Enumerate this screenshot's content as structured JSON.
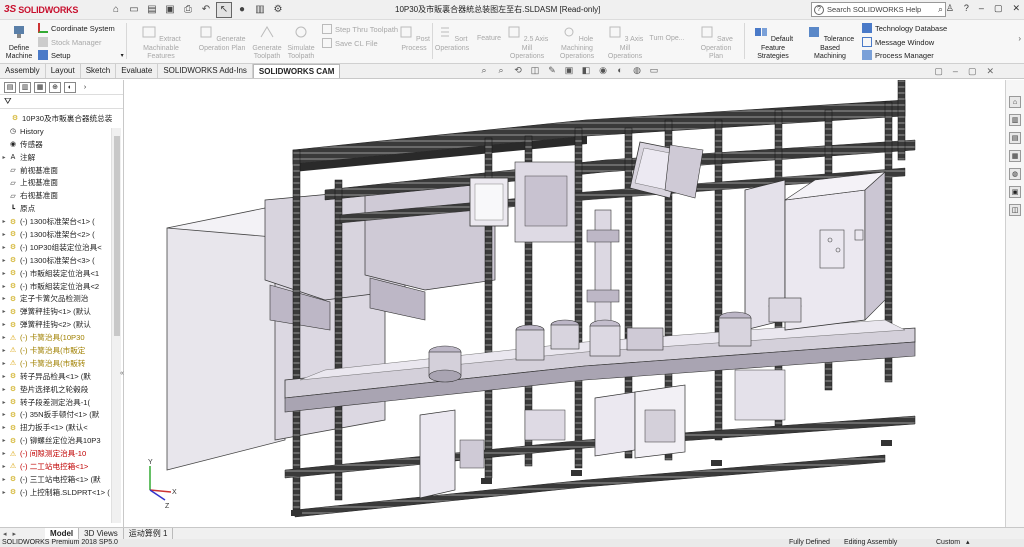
{
  "app": {
    "brand_prefix": "3S",
    "brand_name": "SOLIDWORKS",
    "window_title": "10P30及市販裏合器統总装图左至右.SLDASM [Read-only]",
    "help_search_placeholder": "Search SOLIDWORKS Help"
  },
  "ribbon": {
    "define_machine": "Define\nMachine",
    "coordinate_system": "Coordinate System",
    "stock_manager": "Stock Manager",
    "setup": "Setup",
    "extract_features": "Extract Machinable\nFeatures",
    "generate_operation_plan": "Generate\nOperation Plan",
    "generate_toolpath": "Generate\nToolpath",
    "simulate_toolpath": "Simulate\nToolpath",
    "step_thru_toolpath": "Step Thru Toolpath",
    "save_cl_file": "Save CL File",
    "post_process": "Post\nProcess",
    "sort_operations": "Sort\nOperations",
    "feature": "Feature",
    "mill_25": "2.5 Axis Mill\nOperations",
    "hole_machining": "Hole Machining\nOperations",
    "mill_3": "3 Axis Mill\nOperations",
    "turn_ops": "Turn Ope...",
    "save_operation_plan": "Save Operation\nPlan",
    "default_feature_strategies": "Default Feature\nStrategies",
    "tolerance_based_machining": "Tolerance Based\nMachining",
    "technology_database": "Technology Database",
    "message_window": "Message Window",
    "process_manager": "Process Manager"
  },
  "tabs": [
    "Assembly",
    "Layout",
    "Sketch",
    "Evaluate",
    "SOLIDWORKS Add-Ins",
    "SOLIDWORKS CAM"
  ],
  "active_tab": "SOLIDWORKS CAM",
  "feature_tree": {
    "items": [
      {
        "label": "10P30及市販裏合器统总装",
        "icon": "assembly-icon",
        "arrow": "",
        "state": "root"
      },
      {
        "label": "History",
        "icon": "history-icon",
        "arrow": "",
        "state": ""
      },
      {
        "label": "传感器",
        "icon": "sensor-icon",
        "arrow": "",
        "state": ""
      },
      {
        "label": "注解",
        "icon": "annotation-icon",
        "arrow": "▸",
        "state": ""
      },
      {
        "label": "前视基准面",
        "icon": "plane-icon",
        "arrow": "",
        "state": ""
      },
      {
        "label": "上视基准面",
        "icon": "plane-icon",
        "arrow": "",
        "state": ""
      },
      {
        "label": "右视基准面",
        "icon": "plane-icon",
        "arrow": "",
        "state": ""
      },
      {
        "label": "原点",
        "icon": "origin-icon",
        "arrow": "",
        "state": ""
      },
      {
        "label": "(-) 1300标准架台<1> (",
        "icon": "part-icon",
        "arrow": "▸",
        "state": ""
      },
      {
        "label": "(-) 1300标准架台<2> (",
        "icon": "part-icon",
        "arrow": "▸",
        "state": ""
      },
      {
        "label": "(-) 10P30组装定位治具<",
        "icon": "part-icon",
        "arrow": "▸",
        "state": ""
      },
      {
        "label": "(-) 1300标准架台<3> (",
        "icon": "part-icon",
        "arrow": "▸",
        "state": ""
      },
      {
        "label": "(-) 市販組装定位治具<1",
        "icon": "part-icon",
        "arrow": "▸",
        "state": ""
      },
      {
        "label": "(-) 市販組装定位治具<2",
        "icon": "part-icon",
        "arrow": "▸",
        "state": ""
      },
      {
        "label": "定子卡簧欠品检测治",
        "icon": "part-icon",
        "arrow": "▸",
        "state": ""
      },
      {
        "label": "弹簧秤挂钩<1> (默认",
        "icon": "part-icon",
        "arrow": "▸",
        "state": ""
      },
      {
        "label": "弹簧秤挂钩<2> (默认",
        "icon": "part-icon",
        "arrow": "▸",
        "state": ""
      },
      {
        "label": "(-) 卡簧治具(10P30",
        "icon": "warn-part-icon",
        "arrow": "▸",
        "state": "warn"
      },
      {
        "label": "(-) 卡簧治具(市販定",
        "icon": "warn-part-icon",
        "arrow": "▸",
        "state": "warn"
      },
      {
        "label": "(-) 卡簧治具(市販转",
        "icon": "warn-part-icon",
        "arrow": "▸",
        "state": "warn"
      },
      {
        "label": "转子异品检具<1> (默",
        "icon": "part-icon",
        "arrow": "▸",
        "state": ""
      },
      {
        "label": "垫片选择机之轮毂段",
        "icon": "part-icon",
        "arrow": "▸",
        "state": ""
      },
      {
        "label": "转子段差测定治具-1(",
        "icon": "part-icon",
        "arrow": "▸",
        "state": ""
      },
      {
        "label": "(-) 35N扳手顿付<1> (默",
        "icon": "part-icon",
        "arrow": "▸",
        "state": ""
      },
      {
        "label": "扭力扳手<1> (默认<",
        "icon": "part-icon",
        "arrow": "▸",
        "state": ""
      },
      {
        "label": "(-) 铆螺丝定位治具10P3",
        "icon": "part-icon",
        "arrow": "▸",
        "state": ""
      },
      {
        "label": "(-) 间隙测定治具-10",
        "icon": "warn-part-icon",
        "arrow": "▸",
        "state": "err"
      },
      {
        "label": "(-) 二工站电控箱<1>",
        "icon": "warn-part-icon",
        "arrow": "▸",
        "state": "err"
      },
      {
        "label": "(-) 三工站电控箱<1> (默",
        "icon": "part-icon",
        "arrow": "▸",
        "state": ""
      },
      {
        "label": "(-) 上控制箱.SLDPRT<1> (",
        "icon": "part-icon",
        "arrow": "▸",
        "state": ""
      }
    ]
  },
  "bottom_tabs": [
    "Model",
    "3D Views",
    "运动算例 1"
  ],
  "active_bottom_tab": "Model",
  "status": {
    "version": "SOLIDWORKS Premium 2018 SP5.0",
    "definition": "Fully Defined",
    "mode": "Editing Assembly",
    "units": "Custom"
  },
  "colors": {
    "brand_red": "#c8102e",
    "warning_yellow": "#a08000",
    "error_red": "#c00000"
  }
}
